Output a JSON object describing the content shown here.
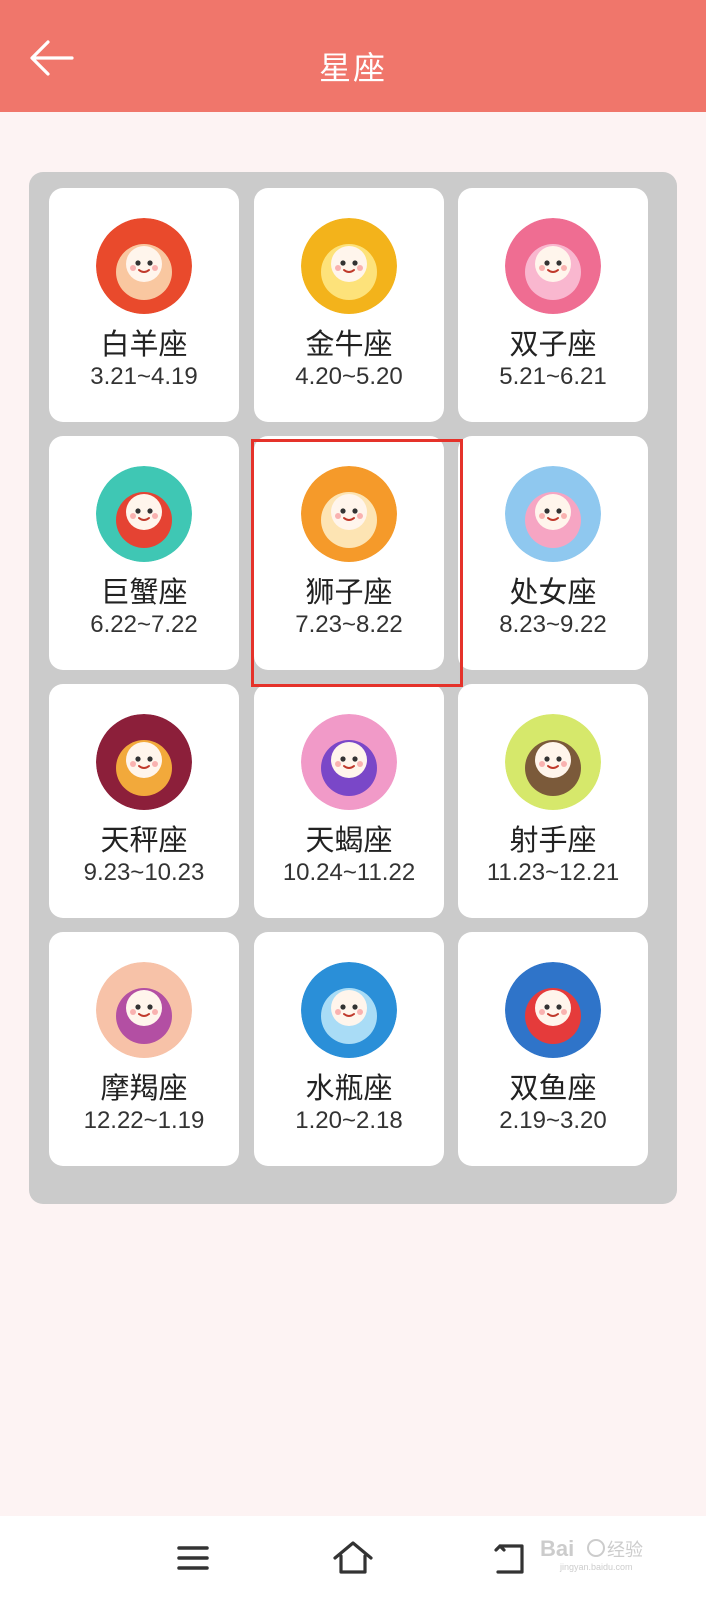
{
  "header": {
    "title": "星座",
    "back_icon": "arrow-left-icon"
  },
  "zodiacs": [
    {
      "name": "白羊座",
      "dates": "3.21~4.19",
      "icon": "aries-ram-avatar",
      "colors": [
        "#e94a2c",
        "#f9c7a0"
      ]
    },
    {
      "name": "金牛座",
      "dates": "4.20~5.20",
      "icon": "taurus-bull-avatar",
      "colors": [
        "#f3b31b",
        "#fde27a"
      ]
    },
    {
      "name": "双子座",
      "dates": "5.21~6.21",
      "icon": "gemini-twins-avatar",
      "colors": [
        "#ef6d92",
        "#f9b7cf"
      ]
    },
    {
      "name": "巨蟹座",
      "dates": "6.22~7.22",
      "icon": "cancer-crab-avatar",
      "colors": [
        "#3fc7b4",
        "#e54333"
      ]
    },
    {
      "name": "狮子座",
      "dates": "7.23~8.22",
      "icon": "leo-lion-avatar",
      "colors": [
        "#f59a2a",
        "#fde4b3"
      ]
    },
    {
      "name": "处女座",
      "dates": "8.23~9.22",
      "icon": "virgo-maiden-avatar",
      "colors": [
        "#8fc8ef",
        "#f6a5c3"
      ]
    },
    {
      "name": "天秤座",
      "dates": "9.23~10.23",
      "icon": "libra-scales-avatar",
      "colors": [
        "#8c1f3a",
        "#f2a93b"
      ]
    },
    {
      "name": "天蝎座",
      "dates": "10.24~11.22",
      "icon": "scorpio-girl-avatar",
      "colors": [
        "#f19ac8",
        "#7a47c8"
      ]
    },
    {
      "name": "射手座",
      "dates": "11.23~12.21",
      "icon": "sagittarius-archer-avatar",
      "colors": [
        "#d6e86b",
        "#7b5a3a"
      ]
    },
    {
      "name": "摩羯座",
      "dates": "12.22~1.19",
      "icon": "capricorn-girl-avatar",
      "colors": [
        "#f7c2a8",
        "#b34fa3"
      ]
    },
    {
      "name": "水瓶座",
      "dates": "1.20~2.18",
      "icon": "aquarius-water-avatar",
      "colors": [
        "#2a8fd8",
        "#a9dcf6"
      ]
    },
    {
      "name": "双鱼座",
      "dates": "2.19~3.20",
      "icon": "pisces-mermaid-avatar",
      "colors": [
        "#2f74c9",
        "#e53b3b"
      ]
    }
  ],
  "selected_name": "狮子座",
  "navbar": {
    "menu_icon": "menu-icon",
    "home_icon": "home-icon",
    "back_icon": "back-return-icon"
  },
  "watermark": {
    "brand": "Bai",
    "brand_suffix": "经验",
    "url": "jingyan.baidu.com"
  },
  "theme": {
    "header_bg": "#f0766b",
    "page_bg": "#fdf3f3",
    "panel_bg": "#cbcbcb",
    "highlight": "#e5322a"
  }
}
